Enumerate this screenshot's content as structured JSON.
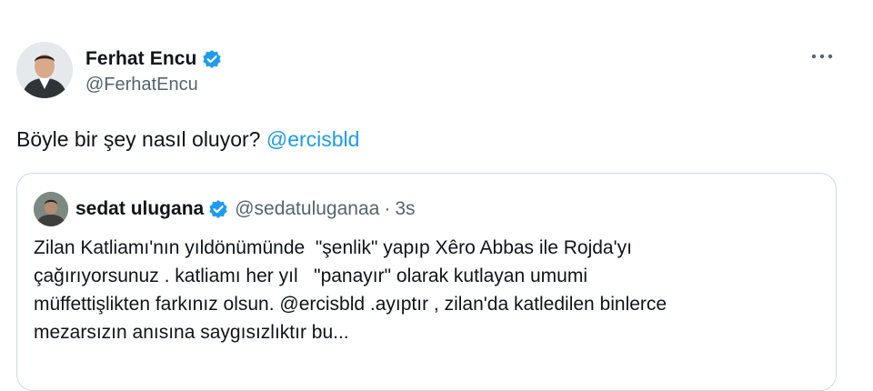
{
  "tweet": {
    "author": {
      "name": "Ferhat Encu",
      "handle": "@FerhatEncu"
    },
    "text": "Böyle bir şey nasıl oluyor? ",
    "mention": "@ercisbld",
    "more_icon": "more-horizontal-icon",
    "verified_icon": "verified-badge-icon"
  },
  "quoted_tweet": {
    "author": {
      "name": "sedat ulugana",
      "handle": "@sedatuluganaa",
      "separator": "·",
      "time": "3s"
    },
    "text": "Zilan Katliamı'nın yıldönümünde  \"şenlik\" yapıp Xêro Abbas ile Rojda'yı\nçağırıyorsunuz . katliamı her yıl   \"panayır\" olarak kutlayan umumi\nmüffettişlikten farkınız olsun. @ercisbld .ayıptır , zilan'da katledilen binlerce\nmezarsızın anısına saygısızlıktır bu..."
  },
  "colors": {
    "accent": "#1d9bf0",
    "secondary_text": "#536471",
    "border": "#cfd9de"
  }
}
